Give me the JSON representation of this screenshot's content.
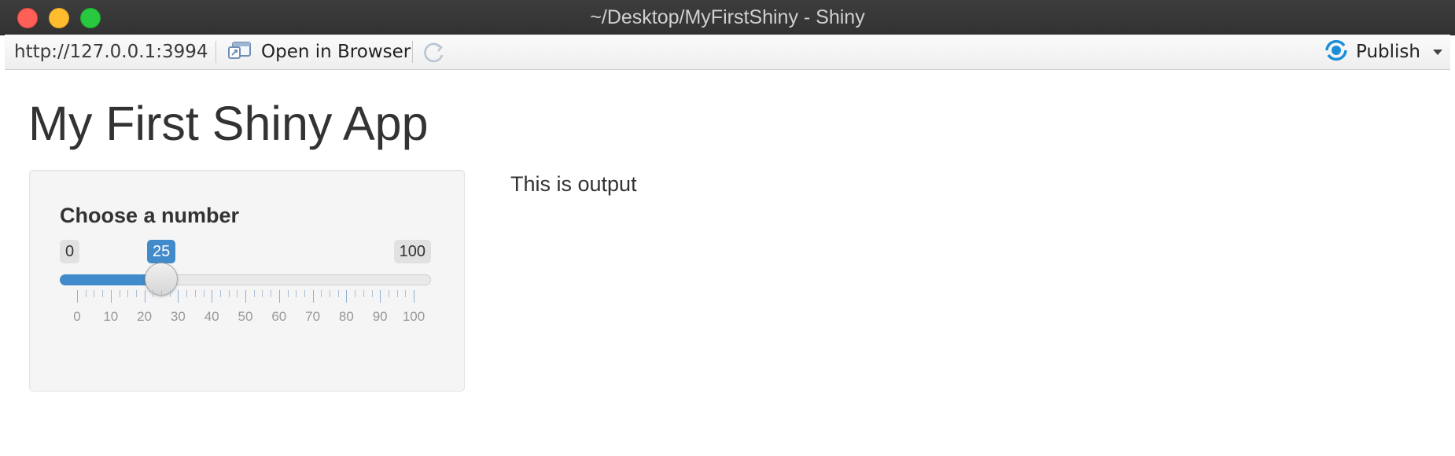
{
  "window": {
    "title": "~/Desktop/MyFirstShiny - Shiny"
  },
  "toolbar": {
    "url": "http://127.0.0.1:3994",
    "open_in_browser_label": "Open in Browser",
    "publish_label": "Publish",
    "accent_color": "#1a8fd8"
  },
  "app": {
    "title": "My First Shiny App",
    "input_label": "Choose a number",
    "slider": {
      "min": 0,
      "max": 100,
      "value": 25,
      "min_label": "0",
      "max_label": "100",
      "value_label": "25",
      "tick_labels": [
        "0",
        "10",
        "20",
        "30",
        "40",
        "50",
        "60",
        "70",
        "80",
        "90",
        "100"
      ],
      "fill_color": "#428bca"
    },
    "output_text": "This is output"
  }
}
